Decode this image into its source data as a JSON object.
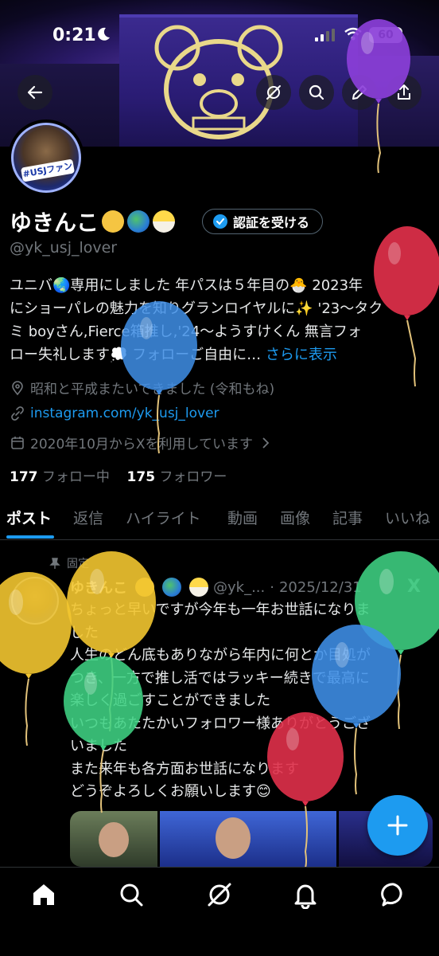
{
  "status_bar": {
    "time": "0:21",
    "battery": "60"
  },
  "profile": {
    "name": "ゆきんこ",
    "name_emojis": [
      "cat-face",
      "globe",
      "hatching-chick"
    ],
    "verify_button": "認証を受ける",
    "handle": "@yk_usj_lover",
    "avatar_tag": "#USJファン",
    "bio_lines": [
      "ユニバ🌏専用にしました 年パスは５年目の🐣 2023年",
      "にショーパレの魅力を知りグランロイヤルに✨ '23〜タク",
      "ミ boyさん,Fierce箱推し,'24〜ようすけくん 無言フォ",
      "ロー失礼します💭 フォローご自由に…"
    ],
    "bio_more": "さらに表示",
    "location": "昭和と平成またいできました (令和もね)",
    "website": "instagram.com/yk_usj_lover",
    "joined": "2020年10月からXを利用しています",
    "following_count": "177",
    "following_label": "フォロー中",
    "followers_count": "175",
    "followers_label": "フォロワー"
  },
  "tabs": [
    "ポスト",
    "返信",
    "ハイライト",
    "動画",
    "画像",
    "記事",
    "いいね"
  ],
  "pinned_post": {
    "pinned_label": "固定",
    "author_name": "ゆきんこ",
    "author_handle": "@yk_...",
    "date": "2025/12/31",
    "body_lines": [
      "ちょっと早いですが今年も一年お世話になりま",
      "した",
      "人生のどん底もありながら年内に何とか目処が",
      "つき、一方で推し活ではラッキー続きで最高に",
      "楽しく過ごすことができました",
      "いつもあたたかいフォロワー様ありがとうござ",
      "いました",
      "また来年も各方面お世話になります",
      "どうぞよろしくお願いします😊"
    ]
  },
  "icons": {
    "back": "back-arrow-icon",
    "grok": "grok-icon",
    "search": "search-icon",
    "edit": "edit-icon",
    "share": "share-icon"
  },
  "colors": {
    "accent": "#1d9bf0",
    "muted": "#71767b",
    "balloon_purple": "#8b3fd9",
    "balloon_red": "#e0304a",
    "balloon_blue": "#3f8fe8",
    "balloon_yellow": "#f2c530",
    "balloon_green": "#3fd183"
  }
}
